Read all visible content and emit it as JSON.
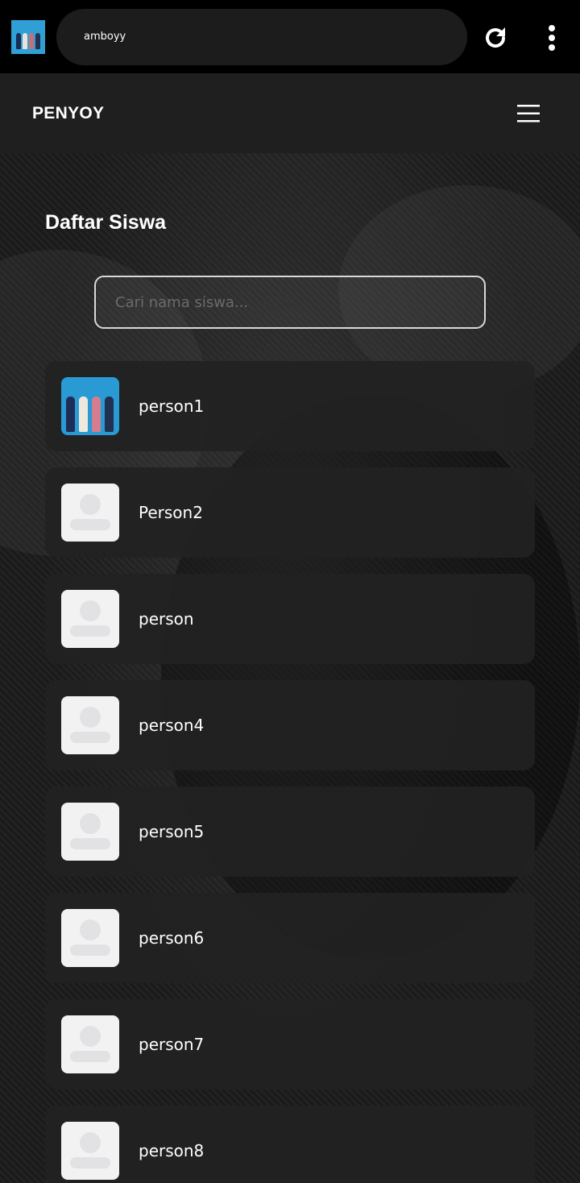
{
  "browser": {
    "url_text": "amboyy",
    "tab_thumbnail": "tab-thumbnail-image",
    "reload_icon": "reload-icon",
    "menu_icon": "more-vert-icon"
  },
  "navbar": {
    "brand": "PENYOY",
    "menu_icon": "hamburger-icon"
  },
  "main": {
    "title": "Daftar Siswa",
    "search": {
      "placeholder": "Cari nama siswa...",
      "value": ""
    },
    "students": [
      {
        "name": "person1",
        "avatar": "photo"
      },
      {
        "name": "Person2",
        "avatar": "default-avatar-icon"
      },
      {
        "name": "person",
        "avatar": "default-avatar-icon"
      },
      {
        "name": "person4",
        "avatar": "default-avatar-icon"
      },
      {
        "name": "person5",
        "avatar": "default-avatar-icon"
      },
      {
        "name": "person6",
        "avatar": "default-avatar-icon"
      },
      {
        "name": "person7",
        "avatar": "default-avatar-icon"
      },
      {
        "name": "person8",
        "avatar": "default-avatar-icon"
      }
    ]
  },
  "colors": {
    "page_bg": "#000000",
    "navbar_bg": "#1f1f1f",
    "card_bg": "#222222",
    "text": "#ffffff"
  }
}
